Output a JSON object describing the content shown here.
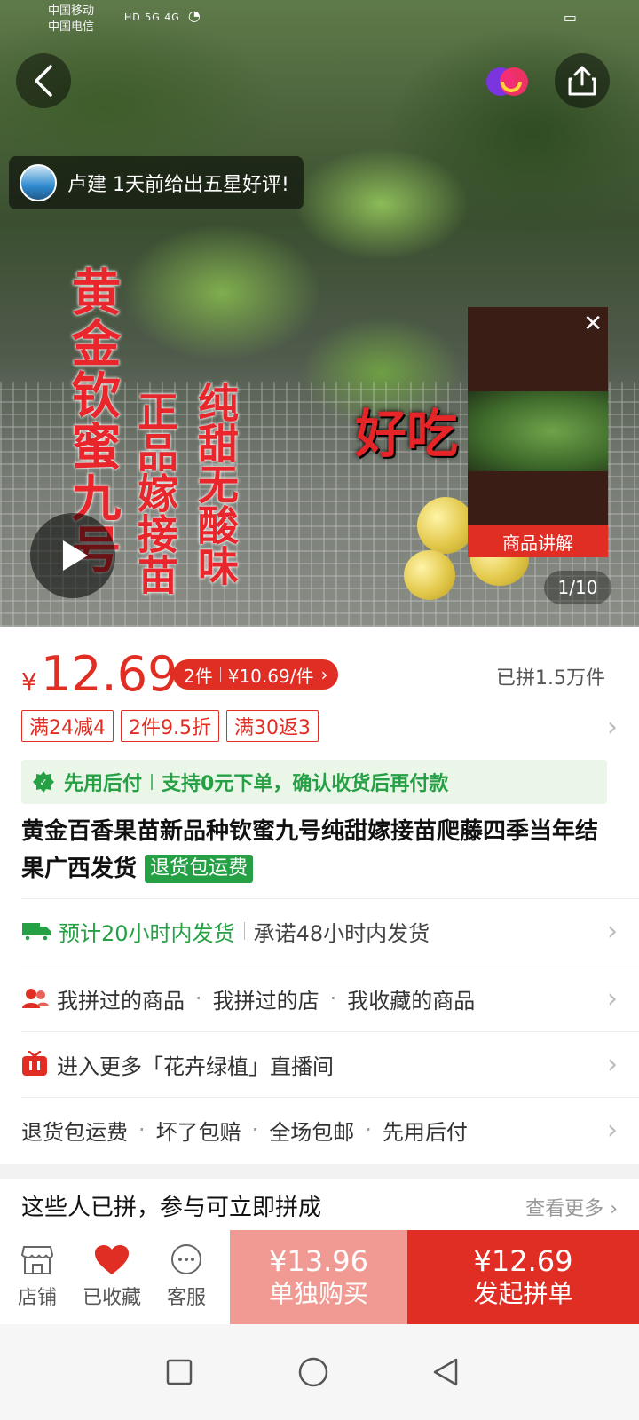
{
  "status_bar": {
    "carrier_1": "中国移动",
    "carrier_2": "中国电信",
    "net_tags": "HD 5G 4G"
  },
  "hero": {
    "review_toast": "卢建 1天前给出五星好评!",
    "overlay_text_1": "黄金钦蜜九号",
    "overlay_text_2": "正品嫁接苗",
    "overlay_text_3": "纯甜无酸味",
    "overlay_caption": "好吃",
    "mini_video_label": "商品讲解",
    "pager": "1/10"
  },
  "price": {
    "currency": "¥",
    "value": "12.69",
    "multi_tag_qty": "2件",
    "multi_tag_price": "¥10.69/件",
    "sold": "已拼1.5万件"
  },
  "coupons": [
    "满24减4",
    "2件9.5折",
    "满30返3"
  ],
  "paylater": {
    "label": "先用后付",
    "desc": "支持0元下单，确认收货后再付款"
  },
  "product": {
    "title": "黄金百香果苗新品种钦蜜九号纯甜嫁接苗爬藤四季当年结果广西发货",
    "badge": "退货包运费"
  },
  "rows": {
    "shipping_estimate": "预计20小时内发货",
    "shipping_promise": "承诺48小时内发货",
    "history": [
      "我拼过的商品",
      "我拼过的店",
      "我收藏的商品"
    ],
    "live": "进入更多「花卉绿植」直播间",
    "services": [
      "退货包运费",
      "坏了包赔",
      "全场包邮",
      "先用后付"
    ]
  },
  "group": {
    "title": "这些人已拼，参与可立即拼成",
    "more": "查看更多"
  },
  "bottom_bar": {
    "store": "店铺",
    "favorited": "已收藏",
    "service": "客服",
    "single_price": "¥13.96",
    "single_label": "单独购买",
    "group_price": "¥12.69",
    "group_label": "发起拼单"
  },
  "colors": {
    "brand_red": "#e02e24",
    "light_red": "#f19a93",
    "green": "#25a044"
  }
}
